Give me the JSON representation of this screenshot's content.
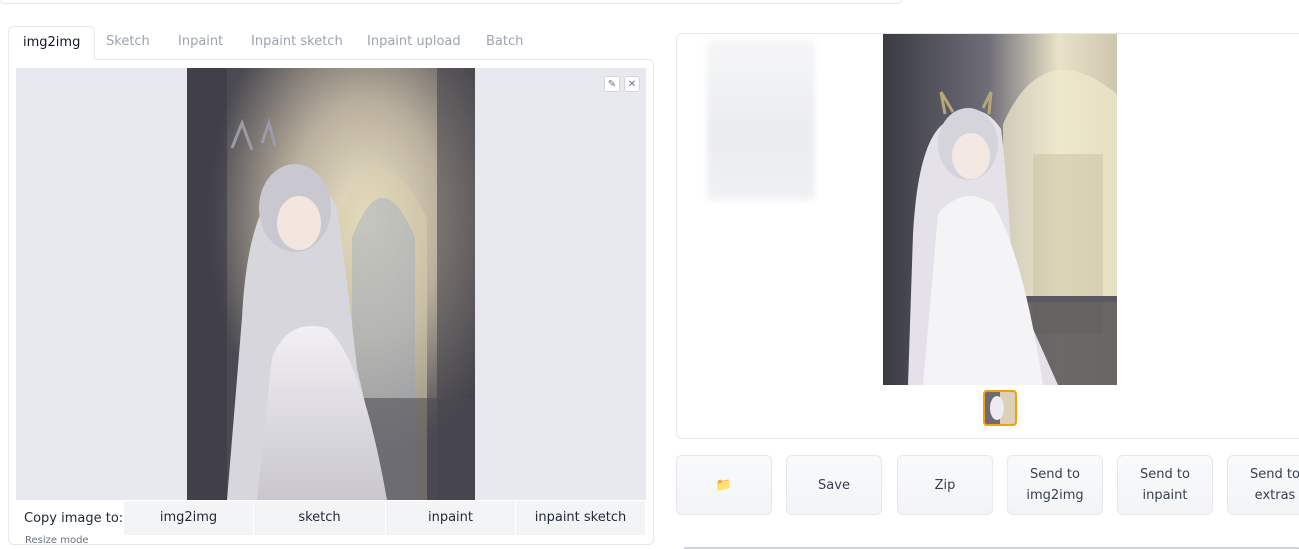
{
  "tabs": [
    "img2img",
    "Sketch",
    "Inpaint",
    "Inpaint sketch",
    "Inpaint upload",
    "Batch"
  ],
  "edit_icons": {
    "edit": "pencil-icon",
    "clear": "close-icon"
  },
  "copy_to": {
    "label": "Copy image to:",
    "buttons": [
      "img2img",
      "sketch",
      "inpaint",
      "inpaint sketch"
    ]
  },
  "resize_mode_label": "Resize mode",
  "actions": [
    {
      "icon": "folder-icon",
      "label": "📁"
    },
    {
      "label": "Save"
    },
    {
      "label": "Zip"
    },
    {
      "label": "Send to\nimg2img"
    },
    {
      "label": "Send to\ninpaint"
    },
    {
      "label": "Send to\nextras"
    }
  ],
  "colors": {
    "accent": "#f59e0b",
    "folder": "#f5c043"
  }
}
